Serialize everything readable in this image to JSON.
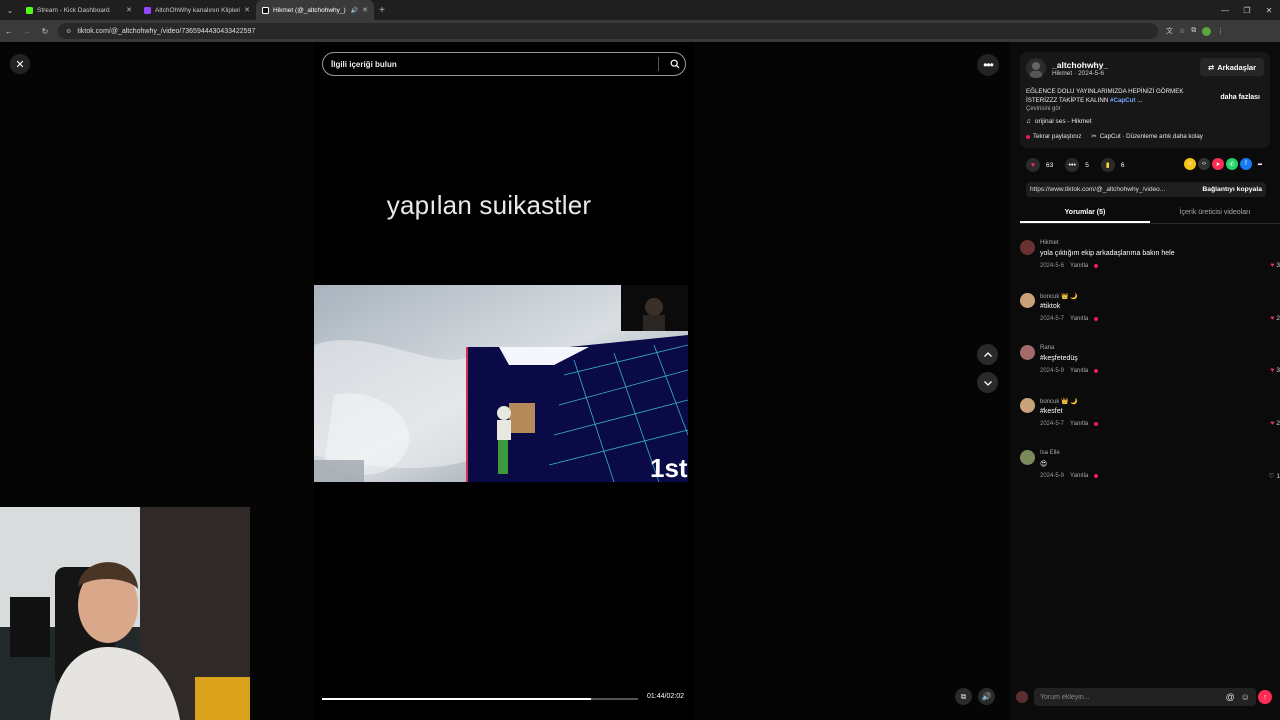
{
  "browser": {
    "tabs": [
      {
        "title": "Stream - Kick Dashboard",
        "favicon_color": "#53fc18",
        "active": false
      },
      {
        "title": "AltchOhWhy kanalının Klipleri",
        "favicon_color": "#9147ff",
        "active": false
      },
      {
        "title": "Hikmet (@_altchohwhy_) | ",
        "favicon_color": "#ffffff",
        "active": true
      }
    ],
    "url": "tiktok.com/@_altchohwhy_/video/7365944430433422597"
  },
  "video": {
    "search_placeholder": "İlgili içeriği bulun",
    "caption": "yapılan suikastler",
    "overlay_text": "1st",
    "time": "01:44/02:02",
    "progress": 0.85
  },
  "post": {
    "username": "_altchohwhy_",
    "meta": "Hikmet · 2024-5-6",
    "friends_label": "Arkadaşlar",
    "description": "EĞLENCE DOLU YAYINLARIMIZDA HEPİNİZİ GÖRMEK İSTERİZZZ TAKİPTE KALINN",
    "hashtag": "#CapCut",
    "ellipsis": " ...",
    "more_label": "daha fazlası",
    "translate_label": "Çevirisini gör",
    "music": "orijinal ses - Hikmet",
    "repost_label": "Tekrar paylaştınız",
    "capcut_label": "CapCut · Düzenleme artık daha kolay",
    "likes": "63",
    "comments": "5",
    "saves": "6",
    "link": "https://www.tiktok.com/@_altchohwhy_/video...",
    "copy_label": "Bağlantıyı kopyala",
    "tab_comments": "Yorumlar (5)",
    "tab_creator": "İçerik üreticisi videoları"
  },
  "comments": [
    {
      "user": "Hikmet",
      "text": "yola çıktığım ekip arkadaşlarıma bakın hele",
      "date": "2024-5-6",
      "reply": "Yanıtla",
      "likes": "3",
      "liked": true,
      "avatar_color": "#6b3030"
    },
    {
      "user": "boncuk 👑 🌙",
      "text": "#tiktok",
      "date": "2024-5-7",
      "reply": "Yanıtla",
      "likes": "2",
      "liked": true,
      "avatar_color": "#c9a27a"
    },
    {
      "user": "Rana",
      "text": "#keşfetedüş",
      "date": "2024-5-9",
      "reply": "Yanıtla",
      "likes": "3",
      "liked": true,
      "avatar_color": "#a46a6a"
    },
    {
      "user": "boncuk 👑 🌙",
      "text": "#kesfet",
      "date": "2024-5-7",
      "reply": "Yanıtla",
      "likes": "2",
      "liked": true,
      "avatar_color": "#c9a27a"
    },
    {
      "user": "Isa Elle",
      "text": "😍",
      "date": "2024-5-9",
      "reply": "Yanıtla",
      "likes": "1",
      "liked": false,
      "avatar_color": "#7a8a5a"
    }
  ],
  "comment_box": {
    "placeholder": "Yorum ekleyin..."
  },
  "colors": {
    "accent": "#fe2c55",
    "link": "#6fa7ff"
  }
}
